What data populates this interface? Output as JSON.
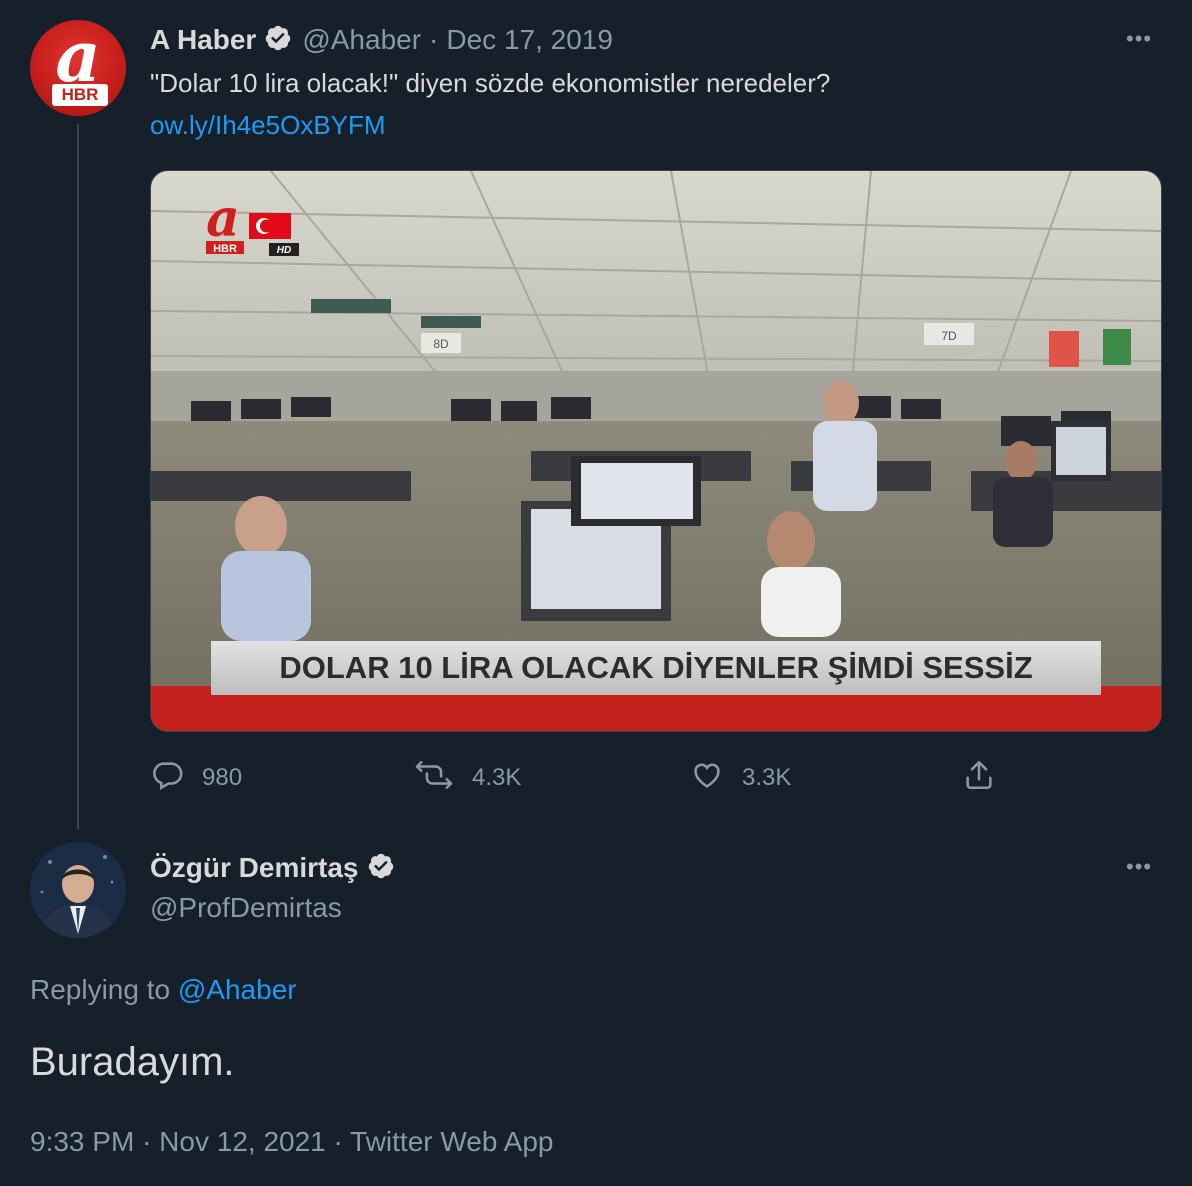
{
  "original_tweet": {
    "avatar_text": "a",
    "avatar_badge": "HBR",
    "name": "A Haber",
    "handle": "@Ahaber",
    "separator": "·",
    "date": "Dec 17, 2019",
    "text": "\"Dolar 10 lira olacak!\" diyen sözde ekonomistler neredeler?",
    "link": "ow.ly/Ih4e5OxBYFM",
    "media": {
      "logo_letter": "a",
      "logo_badge": "HBR",
      "hd_badge": "HD",
      "sign_left": "8D",
      "sign_right": "7D",
      "caption": "DOLAR 10 LİRA OLACAK DİYENLER ŞİMDİ SESSİZ"
    },
    "actions": {
      "replies": "980",
      "retweets": "4.3K",
      "likes": "3.3K"
    },
    "more_icon": "more-horizontal-icon"
  },
  "reply_tweet": {
    "name": "Özgür Demirtaş",
    "handle": "@ProfDemirtas",
    "replying_prefix": "Replying to",
    "replying_handle": "@Ahaber",
    "text": "Buradayım.",
    "time": "9:33 PM",
    "separator": "·",
    "date": "Nov 12, 2021",
    "separator2": "·",
    "source": "Twitter Web App"
  },
  "colors": {
    "background": "#15202b",
    "text": "#d9d9d9",
    "secondary": "#8b98a5",
    "link": "#1d9bf0",
    "brand_red": "#c71f1c"
  }
}
